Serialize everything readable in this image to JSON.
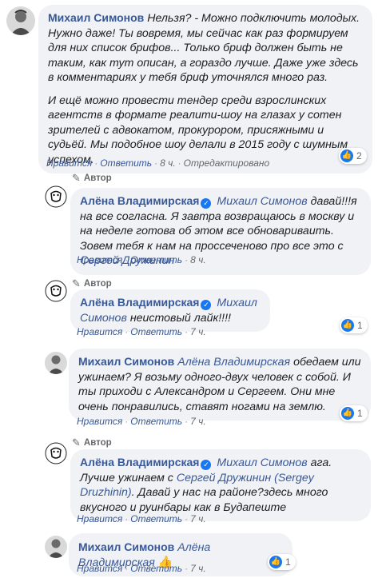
{
  "c1": {
    "author": "Михаил Симонов",
    "text_p1_after_author": "Нельзя? - Можно подключить молодых. Нужно даже! Ты вовремя, мы сейчас как раз формируем для них список брифов... Только бриф должен быть не таким, как тут описан, а гораздо лучше. Даже уже здесь в комментариях у тебя бриф уточнялся много раз.",
    "text_p2": "И ещё можно провести тендер среди взрослинских агентств в формате реалити-шоу на глазах у сотен зрителей с адвокатом, прокурором, присяжными и судьёй. Мы подобное шоу делали в 2015 году с шумным успехом.",
    "reactions": "2",
    "like": "Нравится",
    "reply": "Ответить",
    "time": "8 ч.",
    "edited": "Отредактировано"
  },
  "c2": {
    "badge": "Автор",
    "author": "Алёна Владимирская",
    "mention1": "Михаил Симонов",
    "text": "давай!!!я на все согласна. Я завтра возвращаюсь в москву и на неделе готова об этом все обновариваить. Зовем тебя к нам на проссеченово про все это с",
    "mention2": "Сергей Дружинин",
    "like": "Нравится",
    "reply": "Ответить",
    "time": "8 ч."
  },
  "c3": {
    "badge": "Автор",
    "author": "Алёна Владимирская",
    "mention1": "Михаил Симонов",
    "text": "неистовый лайк!!!!",
    "reactions": "1",
    "like": "Нравится",
    "reply": "Ответить",
    "time": "7 ч."
  },
  "c4": {
    "author": "Михаил Симонов",
    "mention1": "Алёна Владимирская",
    "text": "обедаем или ужинаем? Я возьму одного-двух человек с собой. И ты приходи с Александром и Сергеем. Они мне очень понравились, ставят ногами на землю.",
    "reactions": "1",
    "like": "Нравится",
    "reply": "Ответить",
    "time": "7 ч."
  },
  "c5": {
    "badge": "Автор",
    "author": "Алёна Владимирская",
    "mention1": "Михаил Симонов",
    "text1": "ага. Лучше ужинаем с",
    "mention2": "Сергей Дружинин (Sergey Druzhinin)",
    "text2": ". Давай у нас на районе?здесь много вкусного и руинбары как в Будапеште",
    "like": "Нравится",
    "reply": "Ответить",
    "time": "7 ч."
  },
  "c6": {
    "author": "Михаил Симонов",
    "mention1": "Алёна Владимирская",
    "reactions": "1",
    "like": "Нравится",
    "reply": "Ответить",
    "time": "7 ч."
  },
  "colors": {
    "link": "#385898",
    "bubble": "#f0f2f5",
    "like": "#1877f2",
    "meta": "#65676b"
  }
}
